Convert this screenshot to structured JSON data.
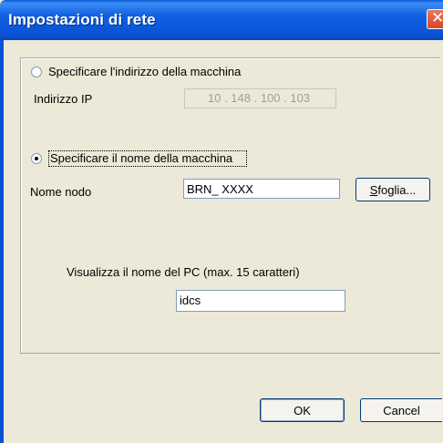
{
  "window": {
    "title": "Impostazioni di rete",
    "close_glyph": "✕"
  },
  "address_option": {
    "label": "Specificare l'indirizzo della macchina",
    "selected": false,
    "ip_label": "Indirizzo IP",
    "ip_value": "10 . 148 . 100 . 103"
  },
  "name_option": {
    "label": "Specificare il nome della macchina",
    "selected": true,
    "node_label": "Nome nodo",
    "node_value": "BRN_ XXXX",
    "browse_label": "Sfoglia...",
    "browse_mnemonic": "S",
    "browse_rest": "foglia..."
  },
  "pc_name": {
    "label": "Visualizza il nome del PC (max. 15 caratteri)",
    "value": "idcs"
  },
  "buttons": {
    "ok": "OK",
    "cancel": "Cancel"
  },
  "colors": {
    "titlebar": "#0a53d6",
    "dialog_bg": "#ece9d8",
    "close": "#d9452a"
  }
}
